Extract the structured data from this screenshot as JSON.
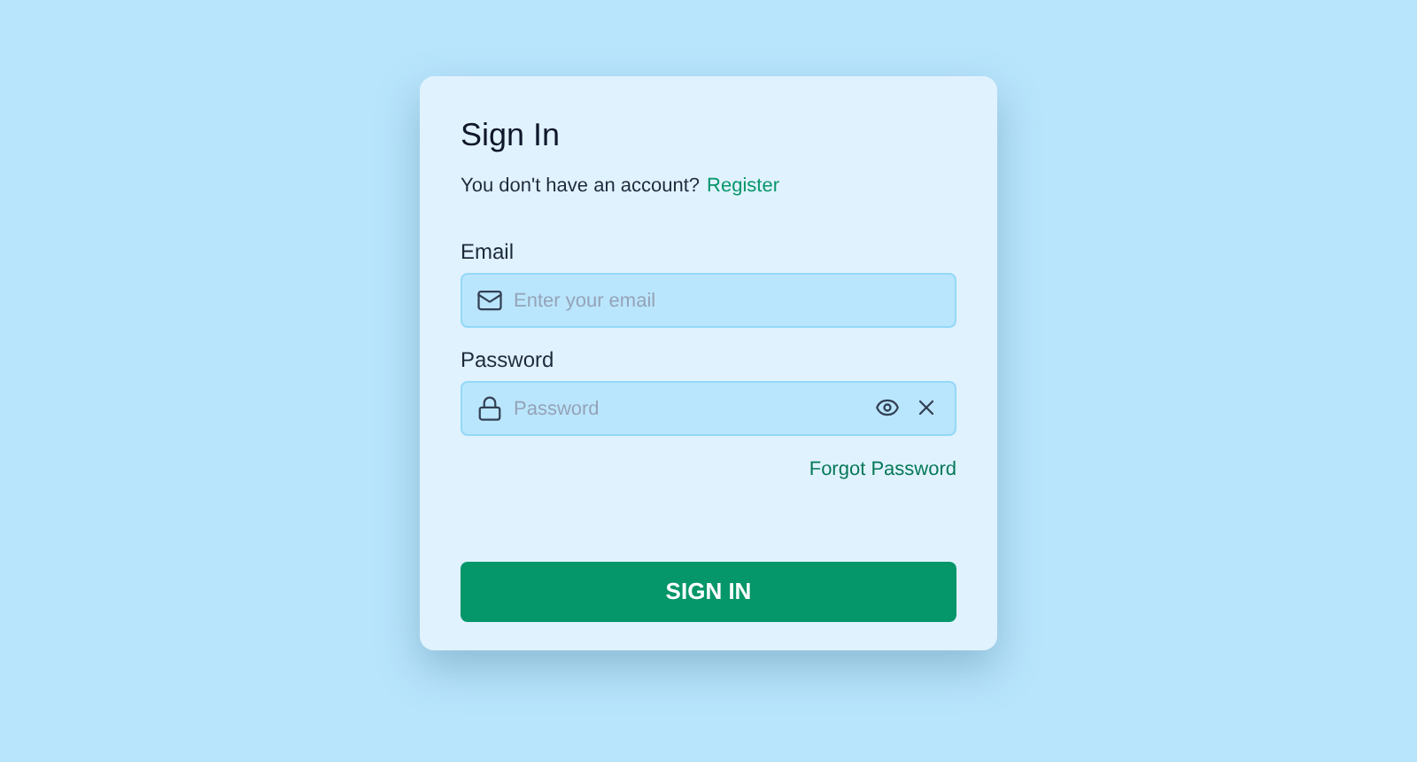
{
  "title": "Sign In",
  "prompt": {
    "text": "You don't have an account?",
    "link": "Register"
  },
  "fields": [
    {
      "kind": "email",
      "label": "Email",
      "placeholder": "Enter your email"
    },
    {
      "kind": "password",
      "label": "Password",
      "placeholder": "Password"
    }
  ],
  "forgot_link": "Forgot Password",
  "submit": "SIGN IN"
}
